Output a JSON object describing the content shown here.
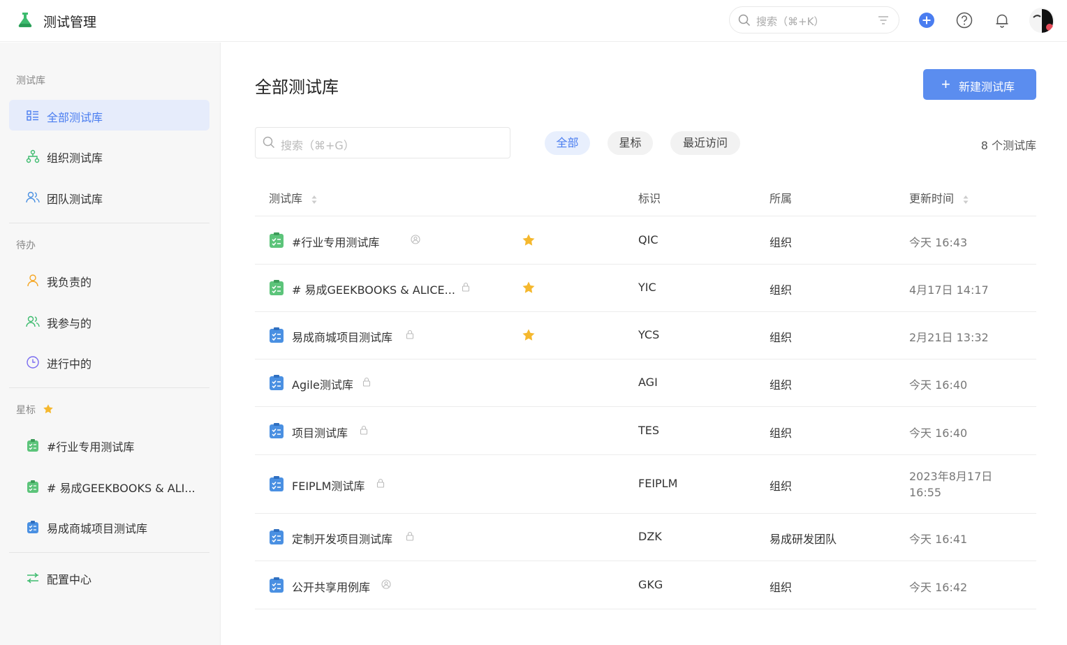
{
  "app": {
    "title": "测试管理"
  },
  "topbar": {
    "search_placeholder": "搜索（⌘+K）"
  },
  "sidebar": {
    "section_repos": "测试库",
    "items_repos": [
      {
        "label": "全部测试库",
        "icon": "list-icon",
        "active": true
      },
      {
        "label": "组织测试库",
        "icon": "org-icon"
      },
      {
        "label": "团队测试库",
        "icon": "team-icon"
      }
    ],
    "section_todo": "待办",
    "items_todo": [
      {
        "label": "我负责的",
        "icon": "user-icon"
      },
      {
        "label": "我参与的",
        "icon": "users-icon"
      },
      {
        "label": "进行中的",
        "icon": "clock-icon"
      }
    ],
    "section_star": "星标",
    "items_star": [
      {
        "label": "#行业专用测试库",
        "icon": "repo-green-icon"
      },
      {
        "label": "# 易成GEEKBOOKS & ALI...",
        "icon": "repo-green-icon"
      },
      {
        "label": "易成商城项目测试库",
        "icon": "repo-blue-icon"
      }
    ],
    "config": {
      "label": "配置中心",
      "icon": "sliders-icon"
    }
  },
  "main": {
    "title": "全部测试库",
    "new_button": "新建测试库",
    "search_placeholder": "搜索（⌘+G）",
    "filters": [
      "全部",
      "星标",
      "最近访问"
    ],
    "count": "8 个测试库",
    "columns": {
      "repo": "测试库",
      "key": "标识",
      "owner": "所属",
      "updated": "更新时间"
    },
    "rows": [
      {
        "name": "#行业专用测试库",
        "key": "QIC",
        "owner": "组织",
        "updated": "今天 16:43",
        "starred": true,
        "color": "green",
        "mini": "user-circle-icon"
      },
      {
        "name": "# 易成GEEKBOOKS & ALICE...",
        "key": "YIC",
        "owner": "组织",
        "updated": "4月17日 14:17",
        "starred": true,
        "color": "green",
        "mini": "lock-icon"
      },
      {
        "name": "易成商城项目测试库",
        "key": "YCS",
        "owner": "组织",
        "updated": "2月21日 13:32",
        "starred": true,
        "color": "blue",
        "mini": "lock-icon"
      },
      {
        "name": "Agile测试库",
        "key": "AGI",
        "owner": "组织",
        "updated": "今天 16:40",
        "starred": false,
        "color": "blue",
        "mini": "lock-icon"
      },
      {
        "name": "项目测试库",
        "key": "TES",
        "owner": "组织",
        "updated": "今天 16:40",
        "starred": false,
        "color": "blue",
        "mini": "lock-icon"
      },
      {
        "name": "FEIPLM测试库",
        "key": "FEIPLM",
        "owner": "组织",
        "updated_line1": "2023年8月17日",
        "updated_line2": "16:55",
        "starred": false,
        "color": "blue",
        "mini": "lock-icon"
      },
      {
        "name": "定制开发项目测试库",
        "key": "DZK",
        "owner": "易成研发团队",
        "updated": "今天 16:41",
        "starred": false,
        "color": "blue",
        "mini": "lock-icon"
      },
      {
        "name": "公开共享用例库",
        "key": "GKG",
        "owner": "组织",
        "updated": "今天 16:42",
        "starred": false,
        "color": "blue",
        "mini": "user-circle-icon"
      }
    ]
  },
  "colors": {
    "accent": "#5b8def",
    "green": "#5cc47a",
    "blue": "#4a90e2",
    "star": "#f5b82e"
  }
}
